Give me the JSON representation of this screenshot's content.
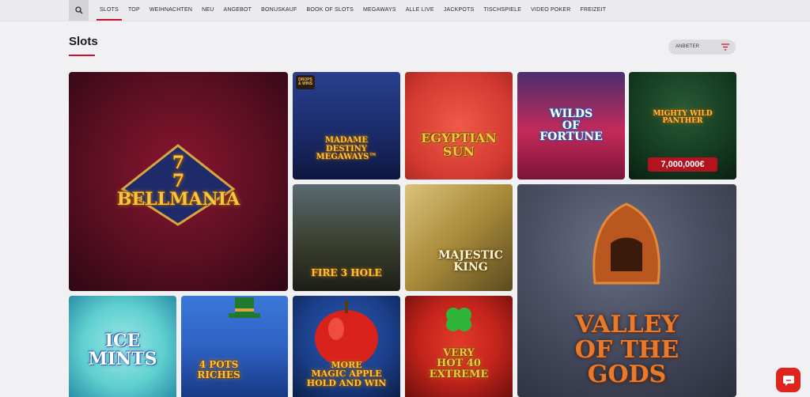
{
  "nav": {
    "items": [
      "SLOTS",
      "TOP",
      "WEIHNACHTEN",
      "NEU",
      "ANGEBOT",
      "BONUSKAUF",
      "BOOK OF SLOTS",
      "MEGAWAYS",
      "ALLE LIVE",
      "JACKPOTS",
      "TISCHSPIELE",
      "VIDEO POKER",
      "FREIZEIT"
    ],
    "active": "SLOTS",
    "search_icon": "search-icon"
  },
  "page": {
    "title": "Slots"
  },
  "filter": {
    "label": "ANBIETER",
    "icon": "filter-icon"
  },
  "games": [
    {
      "id": "bellmania",
      "title": "7\n7\nBELLMANIA",
      "colors": {
        "bg1": "#7a0f22",
        "bg2": "#3a0a1a",
        "accent": "#f6c544"
      }
    },
    {
      "id": "madame-destiny",
      "title": "MADAME\nDESTINY\nMEGAWAYS™",
      "badge": "DROPS\n& WINS",
      "colors": {
        "bg1": "#1f3a8a",
        "bg2": "#0f1d4a"
      }
    },
    {
      "id": "egyptian-sun",
      "title": "EGYPTIAN\nSUN",
      "colors": {
        "bg1": "#e94a3f",
        "bg2": "#c9322c"
      }
    },
    {
      "id": "wilds-of-fortune",
      "title": "WILDS\nOF\nFORTUNE",
      "colors": {
        "bg1": "#cc2a5d",
        "bg2": "#7a1438"
      }
    },
    {
      "id": "mighty-wild-panther",
      "title": "MIGHTY WILD\nPANTHER",
      "jackpot": "7,000,000€",
      "colors": {
        "bg1": "#1d4a2b",
        "bg2": "#0c2215"
      }
    },
    {
      "id": "fire-3-hole",
      "title": "FIRE 3 HOLE",
      "colors": {
        "bg1": "#3a3f2f",
        "bg2": "#1c1f18"
      }
    },
    {
      "id": "majestic-king",
      "title": "MAJESTIC\nKING",
      "colors": {
        "bg1": "#c9b15a",
        "bg2": "#6a5a25"
      }
    },
    {
      "id": "valley-of-the-gods",
      "title": "VALLEY\nOF THE\nGODS",
      "colors": {
        "bg1": "#4a4f63",
        "bg2": "#2c2f3d"
      }
    },
    {
      "id": "ice-mints",
      "title": "ICE\nMINTS",
      "colors": {
        "bg1": "#5fd0cf",
        "bg2": "#2a8fa8"
      }
    },
    {
      "id": "4-pots-riches",
      "title": "4 POTS\nRICHES",
      "colors": {
        "bg1": "#2f62c4",
        "bg2": "#173a85"
      }
    },
    {
      "id": "more-magic-apple",
      "title": "MORE\nMAGIC APPLE\nHOLD AND WIN",
      "colors": {
        "bg1": "#1b3f8a",
        "bg2": "#0c1f4a"
      }
    },
    {
      "id": "very-hot-40-extreme",
      "title": "VERY\nHOT 40\nEXTREME",
      "colors": {
        "bg1": "#c4241c",
        "bg2": "#6e0f0c"
      }
    }
  ],
  "chat": {
    "icon": "chat-icon"
  }
}
